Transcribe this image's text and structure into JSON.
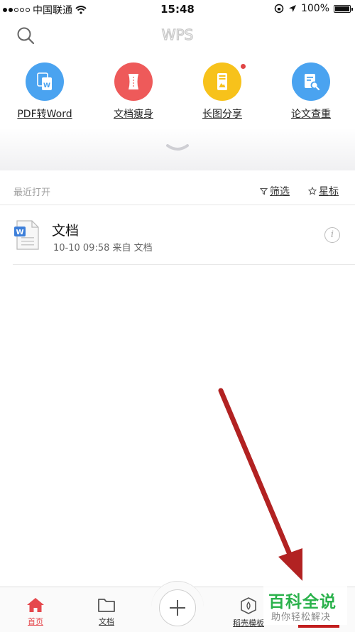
{
  "status_bar": {
    "carrier": "中国联通",
    "time": "15:48",
    "battery": "100%"
  },
  "header": {
    "logo_text": "WPS",
    "search_icon": "search-icon"
  },
  "quick_actions": [
    {
      "label": "PDF转Word",
      "icon": "pdf-to-word-icon",
      "color": "#4aa3f0",
      "badge": false
    },
    {
      "label": "文档瘦身",
      "icon": "doc-slim-icon",
      "color": "#ee5a5a",
      "badge": false
    },
    {
      "label": "长图分享",
      "icon": "long-image-share-icon",
      "color": "#f7c21b",
      "badge": true
    },
    {
      "label": "论文查重",
      "icon": "paper-check-icon",
      "color": "#4aa3f0",
      "badge": false
    }
  ],
  "recent": {
    "title": "最近打开",
    "filter_label": "筛选",
    "star_label": "星标",
    "items": [
      {
        "name": "文档",
        "meta": "10-10 09:58  来自 文档"
      }
    ]
  },
  "tabbar": {
    "tabs": [
      {
        "label": "首页",
        "icon": "home-icon",
        "active": true
      },
      {
        "label": "文档",
        "icon": "folder-icon",
        "active": false
      },
      {
        "label": "稻壳模板",
        "icon": "template-icon",
        "active": false
      }
    ],
    "plus_icon": "plus-icon"
  },
  "watermark": {
    "title": "百科全说",
    "subtitle": "助你轻松解决"
  },
  "colors": {
    "accent_red": "#e5484d",
    "annotation_arrow": "#b22222",
    "watermark_green": "#2bb24c"
  }
}
